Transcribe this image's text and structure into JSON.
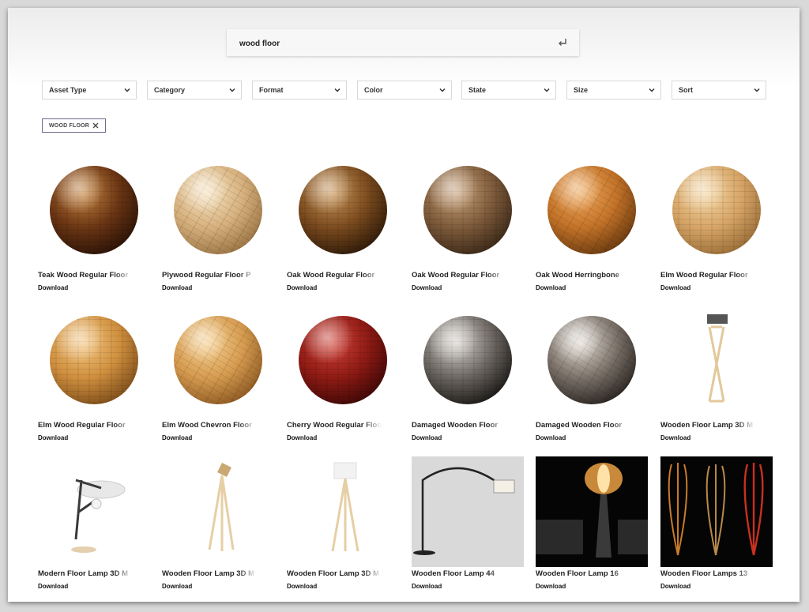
{
  "search": {
    "query": "wood floor"
  },
  "filters": [
    "Asset Type",
    "Category",
    "Format",
    "Color",
    "State",
    "Size",
    "Sort"
  ],
  "active_tags": [
    "WOOD FLOOR"
  ],
  "assets": [
    {
      "title": "Teak Wood Regular Floor",
      "action": "Download",
      "thumb": "sphere",
      "colors": [
        "#c7843e",
        "#6a3514",
        "#2a1206"
      ]
    },
    {
      "title": "Plywood Regular Floor P",
      "action": "Download",
      "thumb": "sphere",
      "colors": [
        "#f6e2bf",
        "#d6b07c",
        "#9a7444"
      ]
    },
    {
      "title": "Oak Wood Regular Floor",
      "action": "Download",
      "thumb": "sphere",
      "colors": [
        "#c99556",
        "#7a4a1e",
        "#2e1a08"
      ]
    },
    {
      "title": "Oak Wood Regular Floor",
      "action": "Download",
      "thumb": "sphere",
      "colors": [
        "#c9a27a",
        "#7d5a3a",
        "#3a2818"
      ]
    },
    {
      "title": "Oak Wood Herringbone",
      "action": "Download",
      "thumb": "sphere",
      "colors": [
        "#f0a85a",
        "#c27228",
        "#6a3a10"
      ]
    },
    {
      "title": "Elm Wood Regular Floor",
      "action": "Download",
      "thumb": "sphere",
      "colors": [
        "#f5d7a4",
        "#d6a466",
        "#9a6e38"
      ]
    },
    {
      "title": "Elm Wood Regular Floor",
      "action": "Download",
      "thumb": "sphere",
      "colors": [
        "#f4c680",
        "#cf8f3e",
        "#7e4e1a"
      ]
    },
    {
      "title": "Elm Wood Chevron Floor",
      "action": "Download",
      "thumb": "sphere",
      "colors": [
        "#f6d08e",
        "#d69b50",
        "#8e5a22"
      ]
    },
    {
      "title": "Cherry Wood Regular Floor",
      "action": "Download",
      "thumb": "sphere",
      "colors": [
        "#d2443a",
        "#8e1a14",
        "#3e0806"
      ]
    },
    {
      "title": "Damaged Wooden Floor",
      "action": "Download",
      "thumb": "sphere",
      "colors": [
        "#d6d2cc",
        "#6b6560",
        "#1a1816"
      ]
    },
    {
      "title": "Damaged Wooden Floor",
      "action": "Download",
      "thumb": "sphere",
      "colors": [
        "#e2dcd2",
        "#7a7068",
        "#2a2420"
      ]
    },
    {
      "title": "Wooden Floor Lamp 3D M",
      "action": "Download",
      "thumb": "lamp-x",
      "colors": [
        "#ffffff",
        "#e2c89a",
        "#555555"
      ]
    },
    {
      "title": "Modern Floor Lamp 3D M",
      "action": "Download",
      "thumb": "lamp-modern",
      "colors": [
        "#ffffff",
        "#3a3a3a",
        "#e8e8e8"
      ]
    },
    {
      "title": "Wooden Floor Lamp 3D M",
      "action": "Download",
      "thumb": "lamp-tripod-spot",
      "colors": [
        "#ffffff",
        "#e6cfa4",
        "#c9a874"
      ]
    },
    {
      "title": "Wooden Floor Lamp 3D M",
      "action": "Download",
      "thumb": "lamp-tripod-shade",
      "colors": [
        "#ffffff",
        "#e6cfa4",
        "#f2f2f2"
      ]
    },
    {
      "title": "Wooden Floor Lamp 44",
      "action": "Download",
      "thumb": "lamp-arc",
      "colors": [
        "#d9d9d9",
        "#222222",
        "#f5f0e6"
      ]
    },
    {
      "title": "Wooden Floor Lamp 16",
      "action": "Download",
      "thumb": "lamp-dark",
      "colors": [
        "#050505",
        "#c9893a",
        "#3a3a3a"
      ]
    },
    {
      "title": "Wooden Floor Lamps 13",
      "action": "Download",
      "thumb": "lamps-trio",
      "colors": [
        "#050505",
        "#c97a2a",
        "#c83020"
      ]
    }
  ]
}
